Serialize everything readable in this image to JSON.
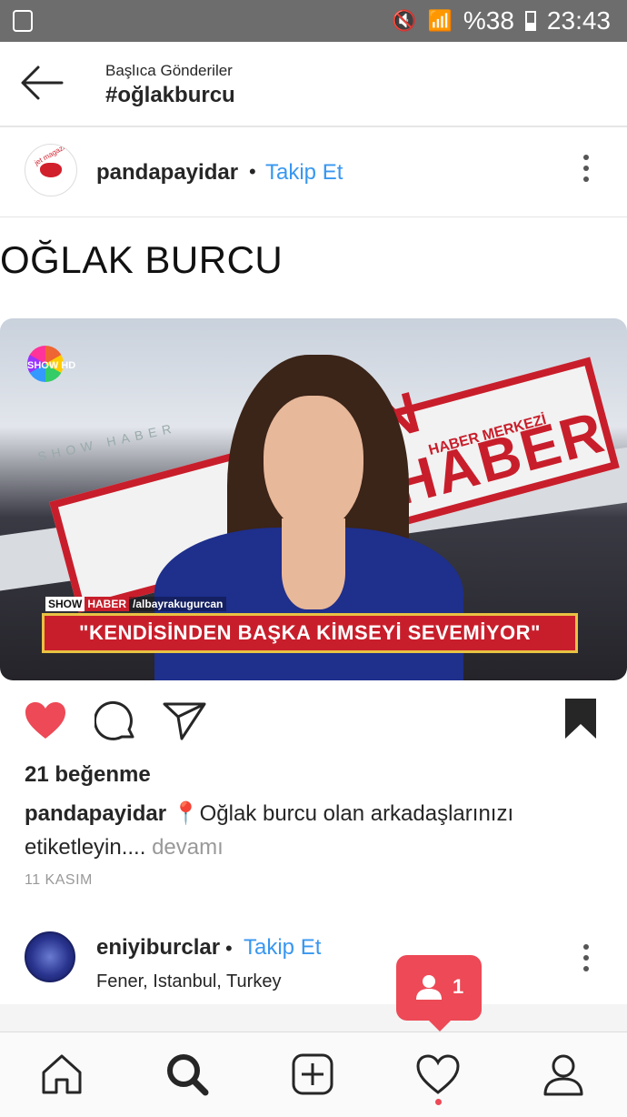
{
  "status_bar": {
    "battery_percent": "%38",
    "time": "23:43"
  },
  "header": {
    "subtitle": "Başlıca Gönderiler",
    "title": "#oğlakburcu"
  },
  "post1": {
    "username": "pandapayidar",
    "separator": "•",
    "follow_label": "Takip Et",
    "avatar_text": "jet magazin",
    "text": "OĞLAK BURCU",
    "image": {
      "banner_word": "N HABER",
      "banner_sub": "HABER MERKEZİ",
      "wall_text": "SHOW HABER",
      "channel_logo": "SHOW HD",
      "tag_show": "SHOW",
      "tag_haber": "HABER",
      "tag_twitter": "/albayrakugurcan",
      "ticker": "\"KENDİSİNDEN BAŞKA KİMSEYİ SEVEMİYOR\""
    },
    "likes": "21 beğenme",
    "caption_user": "pandapayidar",
    "caption_emoji": "📍",
    "caption_text": "Oğlak burcu olan arkadaşlarınızı etiketleyin.",
    "caption_ellipsis": "...",
    "caption_more": "devamı",
    "date": "11 KASIM"
  },
  "post2": {
    "username": "eniyiburclar",
    "separator": "•",
    "follow_label": "Takip Et",
    "location": "Fener, Istanbul, Turkey"
  },
  "notification": {
    "count": "1"
  },
  "colors": {
    "accent_blue": "#3897f0",
    "like_red": "#ed4956",
    "ticker_red": "#c81e2b"
  }
}
